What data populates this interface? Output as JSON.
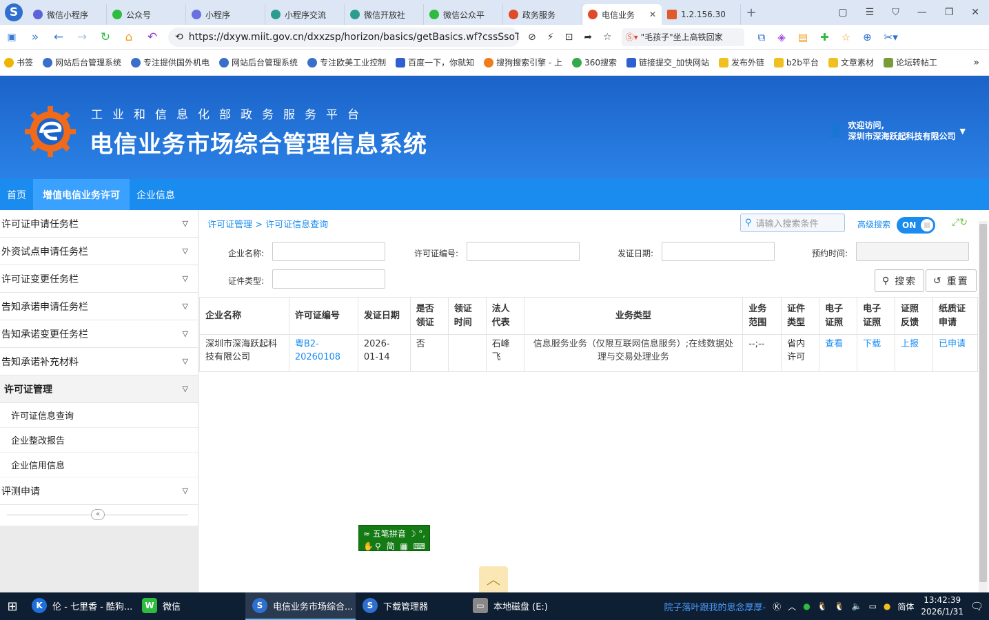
{
  "browser": {
    "tabs": [
      {
        "label": "微信小程序",
        "color": "#5a63d8"
      },
      {
        "label": "公众号",
        "color": "#2dbb40"
      },
      {
        "label": "小程序",
        "color": "#6a70e0"
      },
      {
        "label": "小程序交流",
        "color": "#2a9d8f"
      },
      {
        "label": "微信开放社",
        "color": "#2a9d8f"
      },
      {
        "label": "微信公众平",
        "color": "#2dbb40"
      },
      {
        "label": "政务服务",
        "color": "#e04a2a"
      },
      {
        "label": "电信业务",
        "color": "#e04a2a",
        "active": true
      },
      {
        "label": "1.2.156.30",
        "color": "#e05a2a"
      }
    ],
    "url": "https://dxyw.miit.gov.cn/dxxzsp/horizon/basics/getBasics.wf?cssSsoTic",
    "news": "\"毛孩子\"坐上高铁回家",
    "bookmarks": [
      {
        "label": "书签",
        "color": "#f0b400"
      },
      {
        "label": "网站后台管理系统",
        "color": "#3a6fc9"
      },
      {
        "label": "专注提供国外机电",
        "color": "#3a6fc9"
      },
      {
        "label": "网站后台管理系统",
        "color": "#3a6fc9"
      },
      {
        "label": "专注欧美工业控制",
        "color": "#3a6fc9"
      },
      {
        "label": "百度一下，你就知",
        "color": "#2f5fd0"
      },
      {
        "label": "搜狗搜索引擎 - 上",
        "color": "#f07d1a"
      },
      {
        "label": "360搜索",
        "color": "#35a84a"
      },
      {
        "label": "链接提交_加快网站",
        "color": "#2f5fd0"
      },
      {
        "label": "发布外链",
        "color": "#f0c020"
      },
      {
        "label": "b2b平台",
        "color": "#f0c020"
      },
      {
        "label": "文章素材",
        "color": "#f0c020"
      },
      {
        "label": "论坛转帖工",
        "color": "#7a9b3a"
      }
    ]
  },
  "header": {
    "subtitle": "工业和信息化部政务服务平台",
    "title": "电信业务市场综合管理信息系统",
    "welcome": "欢迎访问,",
    "company": "深圳市深海跃起科技有限公司"
  },
  "nav": [
    "首页",
    "增值电信业务许可",
    "企业信息"
  ],
  "sidebar": {
    "items": [
      "许可证申请任务栏",
      "外资试点申请任务栏",
      "许可证变更任务栏",
      "告知承诺申请任务栏",
      "告知承诺变更任务栏",
      "告知承诺补充材料"
    ],
    "open_item": "许可证管理",
    "subitems": [
      "许可证信息查询",
      "企业整改报告",
      "企业信用信息"
    ],
    "last_item": "评测申请",
    "collapse_glyph": "«"
  },
  "content": {
    "breadcrumb": "许可证管理 > 许可证信息查询",
    "search_placeholder": "请输入搜索条件",
    "advanced_search": "高级搜索",
    "toggle": "ON",
    "form": {
      "company_label": "企业名称:",
      "license_no_label": "许可证编号:",
      "issue_date_label": "发证日期:",
      "appointment_label": "预约时间:",
      "cert_type_label": "证件类型:",
      "search_btn": "搜索",
      "reset_btn": "重置"
    },
    "table": {
      "headers": [
        "企业名称",
        "许可证编号",
        "发证日期",
        "是否领证",
        "领证时间",
        "法人代表",
        "业务类型",
        "业务范围",
        "证件类型",
        "电子证照",
        "电子证照",
        "证照反馈",
        "纸质证申请"
      ],
      "row": {
        "company": "深圳市深海跃起科技有限公司",
        "license_no": "粤B2-20260108",
        "issue_date": "2026-01-14",
        "received": "否",
        "receive_time": "",
        "legal_rep": "石峰飞",
        "biz_type": "信息服务业务（仅限互联网信息服务）;在线数据处理与交易处理业务",
        "scope": "--;--",
        "cert_type": "省内许可",
        "e_view": "查看",
        "e_download": "下载",
        "feedback": "上报",
        "paper": "已申请"
      }
    }
  },
  "ime": {
    "line1": "五笔拼音",
    "line2": "简"
  },
  "taskbar": {
    "items": [
      {
        "label": "伦 - 七里香 - 酷狗...",
        "color": "#1e6fd9",
        "glyph": "K"
      },
      {
        "label": "微信",
        "color": "#2dbb40",
        "glyph": "W"
      },
      {
        "label": "电信业务市场综合...",
        "color": "#2f6fd0",
        "glyph": "S",
        "active": true
      },
      {
        "label": "下载管理器",
        "color": "#2f6fd0",
        "glyph": "S"
      },
      {
        "label": "本地磁盘 (E:)",
        "color": "#888888",
        "glyph": "▭"
      }
    ],
    "marquee": "院子落叶跟我的思念厚厚-",
    "lang": "简体",
    "time": "13:42:39",
    "date": "2026/1/31"
  }
}
